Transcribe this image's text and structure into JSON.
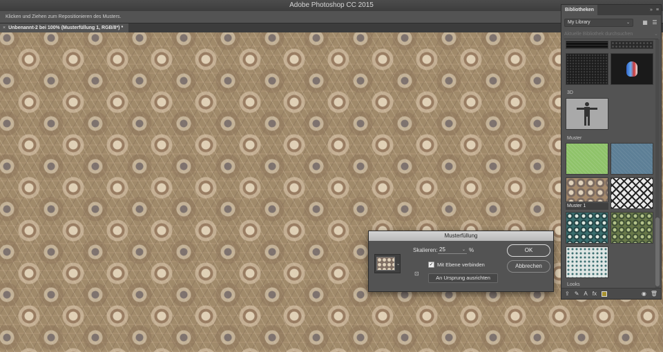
{
  "app": {
    "title": "Adobe Photoshop CC 2015"
  },
  "options_bar": {
    "hint": "Klicken und Ziehen zum Repositionieren des Musters."
  },
  "document": {
    "tab_title": "Unbenannt-2 bei 100% (Musterfüllung 1, RGB/8*) *",
    "close_glyph": "×"
  },
  "libraries_panel": {
    "tab_label": "Bibliotheken",
    "header_icons": [
      "»",
      "≡"
    ],
    "library_select": "My Library",
    "search_placeholder": "Aktuelle Bibliothek durchsuchen",
    "sections": {
      "three_d": "3D",
      "muster": "Muster",
      "looks": "Looks"
    },
    "selected_pattern_caption": "Muster 1",
    "footer_swatch_color": "#a8922f"
  },
  "dialog": {
    "title": "Musterfüllung",
    "scale_label": "Skalieren:",
    "scale_value": "25",
    "scale_unit": "%",
    "link_checkbox_label": "Mit Ebene verbinden",
    "link_checked": true,
    "check_glyph": "✓",
    "align_button": "An Ursprung ausrichten",
    "ok_label": "OK",
    "cancel_label": "Abbrechen"
  },
  "icons": {
    "chevron": "⌄",
    "grid": "▦",
    "list": "☰",
    "upload": "⇪",
    "brush": "✎",
    "text": "A",
    "fx": "fx",
    "eye": "◉",
    "trash": "🗑",
    "snap": "⊡"
  }
}
